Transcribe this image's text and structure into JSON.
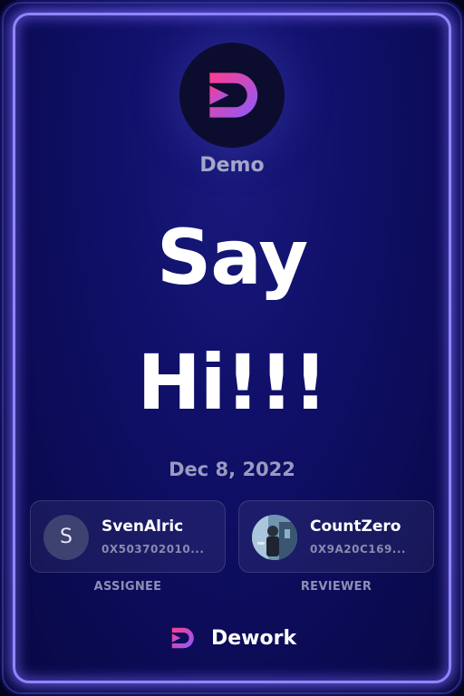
{
  "org": {
    "name": "Demo",
    "logo_icon": "dework-logo-icon"
  },
  "task": {
    "title": "Say\nHi!!!",
    "date": "Dec 8, 2022"
  },
  "assignee": {
    "avatar_letter": "S",
    "name": "SvenAlric",
    "address": "0X503702010...",
    "role": "ASSIGNEE"
  },
  "reviewer": {
    "avatar_icon": "user-photo-avatar",
    "name": "CountZero",
    "address": "0X9A20C169...",
    "role": "REVIEWER"
  },
  "brand": {
    "name": "Dework",
    "logo_icon": "dework-logo-icon"
  },
  "colors": {
    "background": "#10106a",
    "frame_glow": "#8f86ff",
    "logo_gradient_start": "#ff3d8b",
    "logo_gradient_end": "#8a5cff"
  }
}
